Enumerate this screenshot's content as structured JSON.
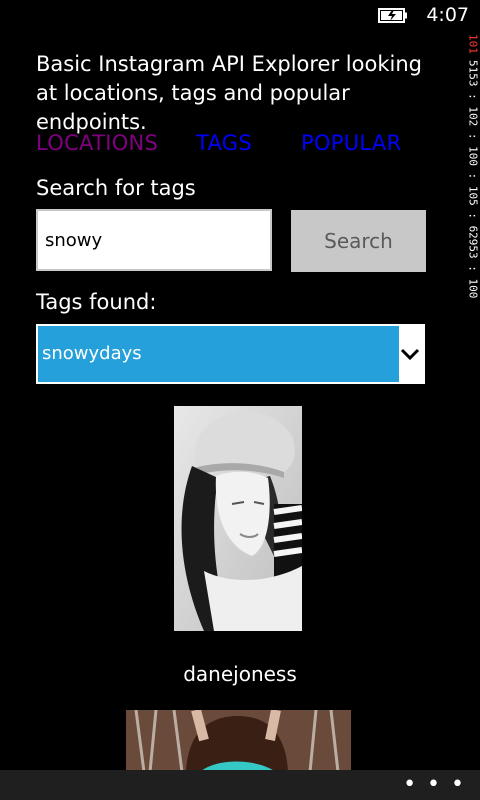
{
  "status_bar": {
    "time": "4:07",
    "battery_icon": "battery-charging-icon"
  },
  "memory_counter": {
    "top": "101",
    "rest": "5153 : 102 : 100 : 105 : 62953 : 100"
  },
  "intro": {
    "text": "Basic Instagram API Explorer looking at locations, tags and popular endpoints."
  },
  "nav": {
    "locations": "LOCATIONS",
    "tags": "TAGS",
    "popular": "POPULAR",
    "colors": {
      "visited": "#800080",
      "link": "#0000ff"
    }
  },
  "search": {
    "label": "Search for tags",
    "value": "snowy",
    "button": "Search"
  },
  "tags": {
    "label": "Tags found:",
    "selected": "snowydays",
    "select_color": "#25a0da",
    "chevron_icon": "chevron-down-icon"
  },
  "results": [
    {
      "username": "danejoness"
    }
  ],
  "app_bar": {
    "more": "• • •"
  }
}
